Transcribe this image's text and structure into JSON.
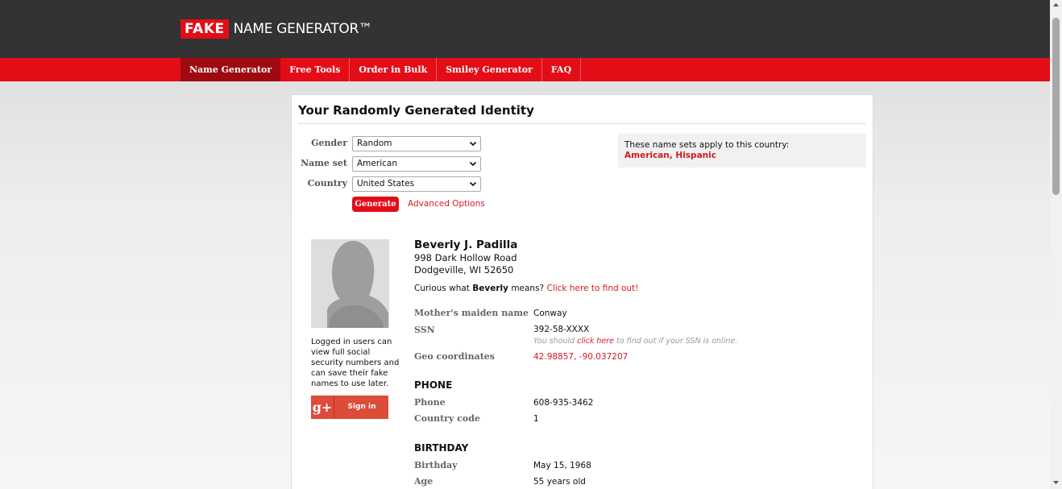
{
  "header": {
    "logo_fake": "FAKE",
    "logo_rest": "NAME GENERATOR™"
  },
  "nav": [
    {
      "label": "Name Generator",
      "active": true
    },
    {
      "label": "Free Tools"
    },
    {
      "label": "Order in Bulk"
    },
    {
      "label": "Smiley Generator"
    },
    {
      "label": "FAQ"
    }
  ],
  "page": {
    "title": "Your Randomly Generated Identity"
  },
  "form": {
    "gender_label": "Gender",
    "gender_value": "Random",
    "nameset_label": "Name set",
    "nameset_value": "American",
    "country_label": "Country",
    "country_value": "United States",
    "generate_label": "Generate",
    "advanced_label": "Advanced Options"
  },
  "country_box": {
    "text": "These name sets apply to this country:",
    "set1": "American",
    "set2": "Hispanic",
    "separator": ", "
  },
  "sidebar": {
    "login_note": "Logged in users can view full social security numbers and can save their fake names to use later.",
    "gplus_icon": "g+",
    "signin_label": "Sign in"
  },
  "identity": {
    "name": "Beverly J. Padilla",
    "address_line1": "998 Dark Hollow Road",
    "address_line2": "Dodgeville, WI 52650",
    "curious_prefix": "Curious what",
    "first_name": "Beverly",
    "curious_suffix": "means?",
    "curious_link": "Click here to find out!",
    "maiden_label": "Mother's maiden name",
    "maiden_value": "Conway",
    "ssn_label": "SSN",
    "ssn_value": "392-58-XXXX",
    "ssn_note_prefix": "You should",
    "ssn_note_link": "click here",
    "ssn_note_suffix": "to find out if your SSN is online.",
    "geo_label": "Geo coordinates",
    "geo_value": "42.98857, -90.037207"
  },
  "phone": {
    "section": "PHONE",
    "phone_label": "Phone",
    "phone_value": "608-935-3462",
    "cc_label": "Country code",
    "cc_value": "1"
  },
  "birthday": {
    "section": "BIRTHDAY",
    "birthday_label": "Birthday",
    "birthday_value": "May 15, 1968",
    "age_label": "Age",
    "age_value": "55 years old"
  },
  "colors": {
    "brand_red": "#e30d18",
    "topbar": "#333333",
    "nav_active": "#9e0a10",
    "link_red": "#d21a22"
  }
}
